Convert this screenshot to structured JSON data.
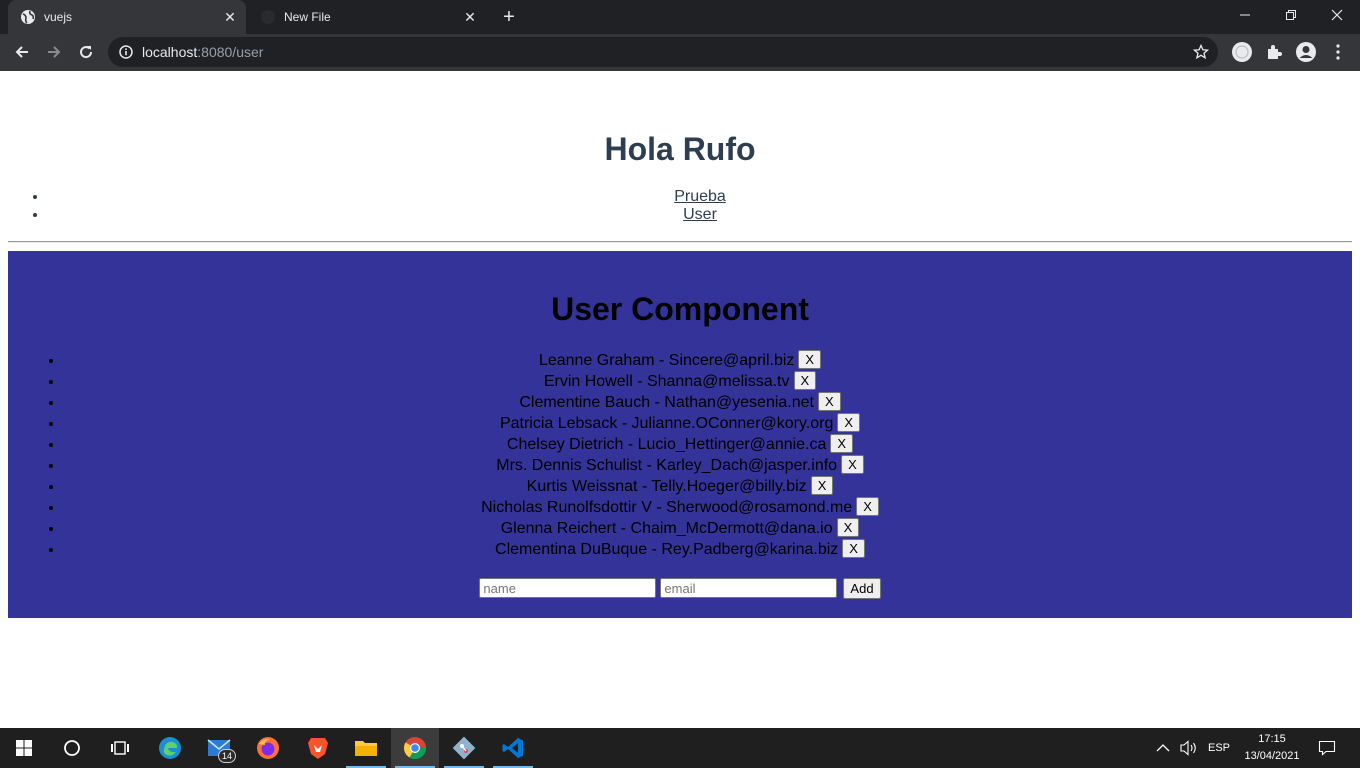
{
  "browser": {
    "tabs": [
      {
        "title": "vuejs",
        "active": true
      },
      {
        "title": "New File",
        "active": false
      }
    ],
    "url_host": "localhost",
    "url_path": ":8080/user"
  },
  "page": {
    "title": "Hola Rufo",
    "nav": [
      {
        "label": "Prueba"
      },
      {
        "label": "User"
      }
    ],
    "user_component": {
      "title": "User Component",
      "users": [
        {
          "text": "Leanne Graham - Sincere@april.biz",
          "btn": "X"
        },
        {
          "text": "Ervin Howell - Shanna@melissa.tv",
          "btn": "X"
        },
        {
          "text": "Clementine Bauch - Nathan@yesenia.net",
          "btn": "X"
        },
        {
          "text": "Patricia Lebsack - Julianne.OConner@kory.org",
          "btn": "X"
        },
        {
          "text": "Chelsey Dietrich - Lucio_Hettinger@annie.ca",
          "btn": "X"
        },
        {
          "text": "Mrs. Dennis Schulist - Karley_Dach@jasper.info",
          "btn": "X"
        },
        {
          "text": "Kurtis Weissnat - Telly.Hoeger@billy.biz",
          "btn": "X"
        },
        {
          "text": "Nicholas Runolfsdottir V - Sherwood@rosamond.me",
          "btn": "X"
        },
        {
          "text": "Glenna Reichert - Chaim_McDermott@dana.io",
          "btn": "X"
        },
        {
          "text": "Clementina DuBuque - Rey.Padberg@karina.biz",
          "btn": "X"
        }
      ],
      "form": {
        "name_placeholder": "name",
        "email_placeholder": "email",
        "add_label": "Add"
      },
      "background": "#343399"
    }
  },
  "taskbar": {
    "apps": [
      "start-icon",
      "search-icon",
      "task-view-icon",
      "edge-icon",
      "mail-icon",
      "firefox-icon",
      "brave-icon",
      "file-explorer-icon",
      "chrome-icon",
      "git-icon",
      "vscode-icon"
    ],
    "mail_badge": "14",
    "language": "ESP",
    "time": "17:15",
    "date": "13/04/2021"
  }
}
